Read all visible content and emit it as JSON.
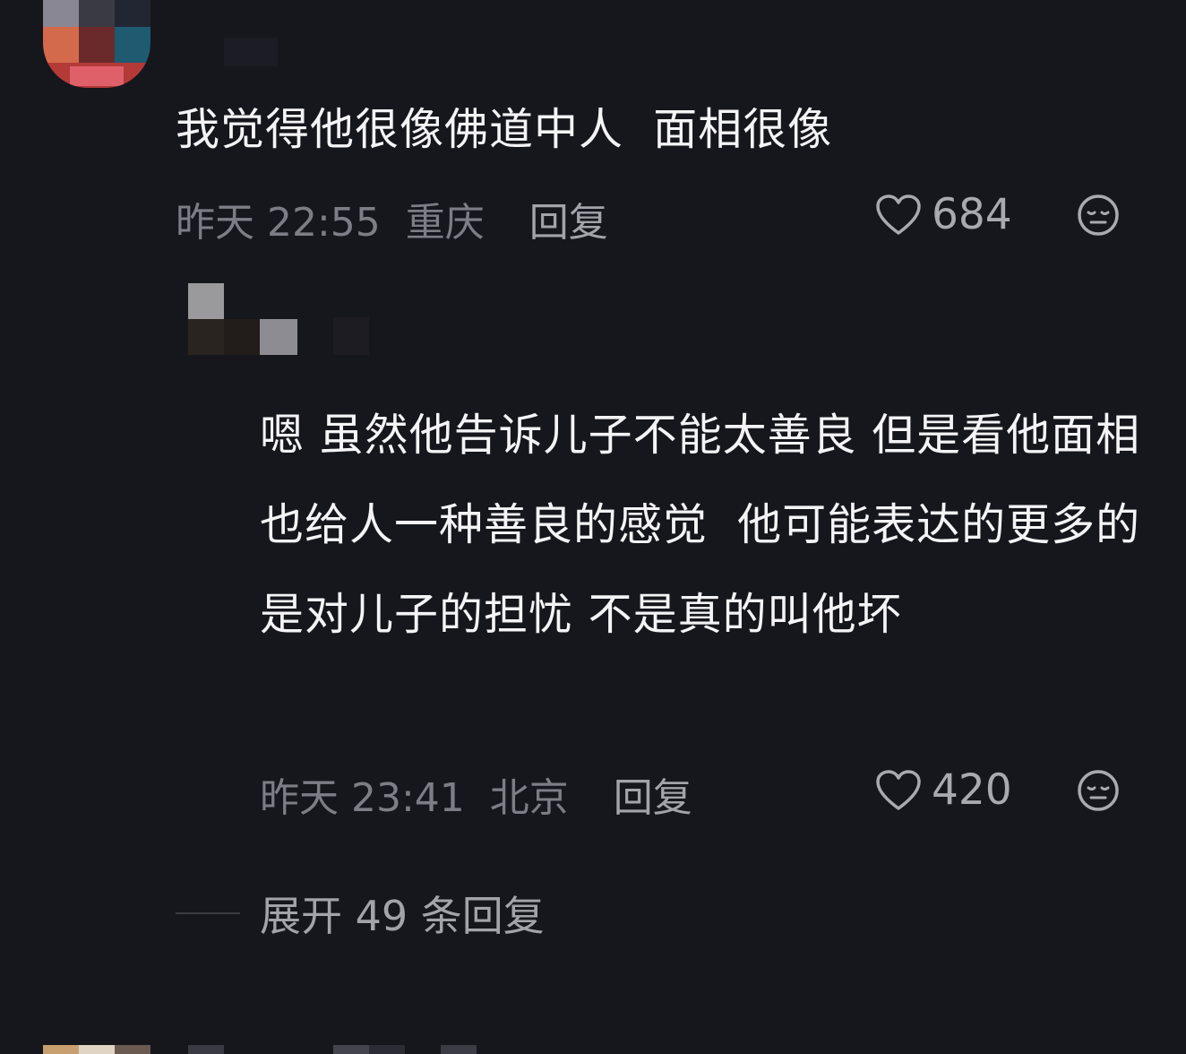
{
  "main_comment": {
    "text": "我觉得他很像佛道中人  面相很像",
    "time": "昨天 22:55",
    "location": "重庆",
    "reply_label": "回复",
    "likes": "684",
    "like_icon": "heart-outline-icon",
    "dislike_icon": "neutral-face-icon"
  },
  "reply_comment": {
    "text": "嗯 虽然他告诉儿子不能太善良 但是看他面相也给人一种善良的感觉  他可能表达的更多的是对儿子的担忧 不是真的叫他坏",
    "time": "昨天 23:41",
    "location": "北京",
    "reply_label": "回复",
    "likes": "420",
    "like_icon": "heart-outline-icon",
    "dislike_icon": "neutral-face-icon"
  },
  "expand_replies": {
    "label": "展开 49 条回复"
  },
  "colors": {
    "background": "#16161d",
    "primary_text": "#f4f4f6",
    "meta_text": "#7d7d86",
    "action_text": "#a3a3aa"
  }
}
